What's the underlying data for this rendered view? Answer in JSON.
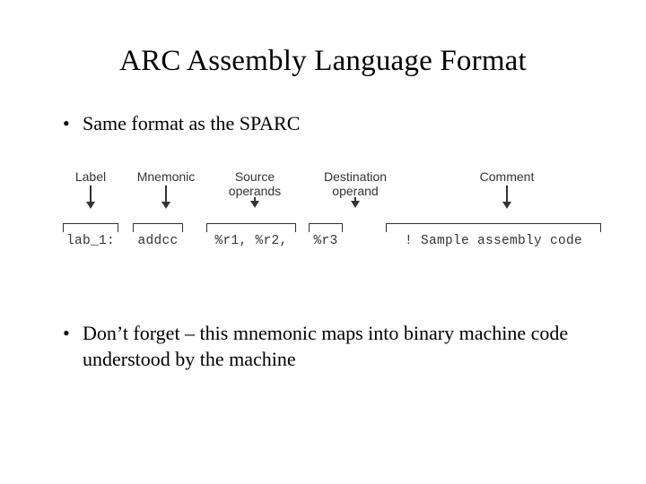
{
  "title": "ARC Assembly Language Format",
  "bullets": {
    "b1": "Same format as the SPARC",
    "b2": "Don’t forget – this mnemonic maps into binary machine code understood by the machine"
  },
  "diagram": {
    "labels": {
      "label": "Label",
      "mnemonic": "Mnemonic",
      "source_l1": "Source",
      "source_l2": "operands",
      "dest_l1": "Destination",
      "dest_l2": "operand",
      "comment": "Comment"
    },
    "code": {
      "label": "lab_1:",
      "mnemonic": "addcc",
      "src": "%r1, %r2,",
      "dst": "%r3",
      "comment": "! Sample assembly code"
    }
  }
}
